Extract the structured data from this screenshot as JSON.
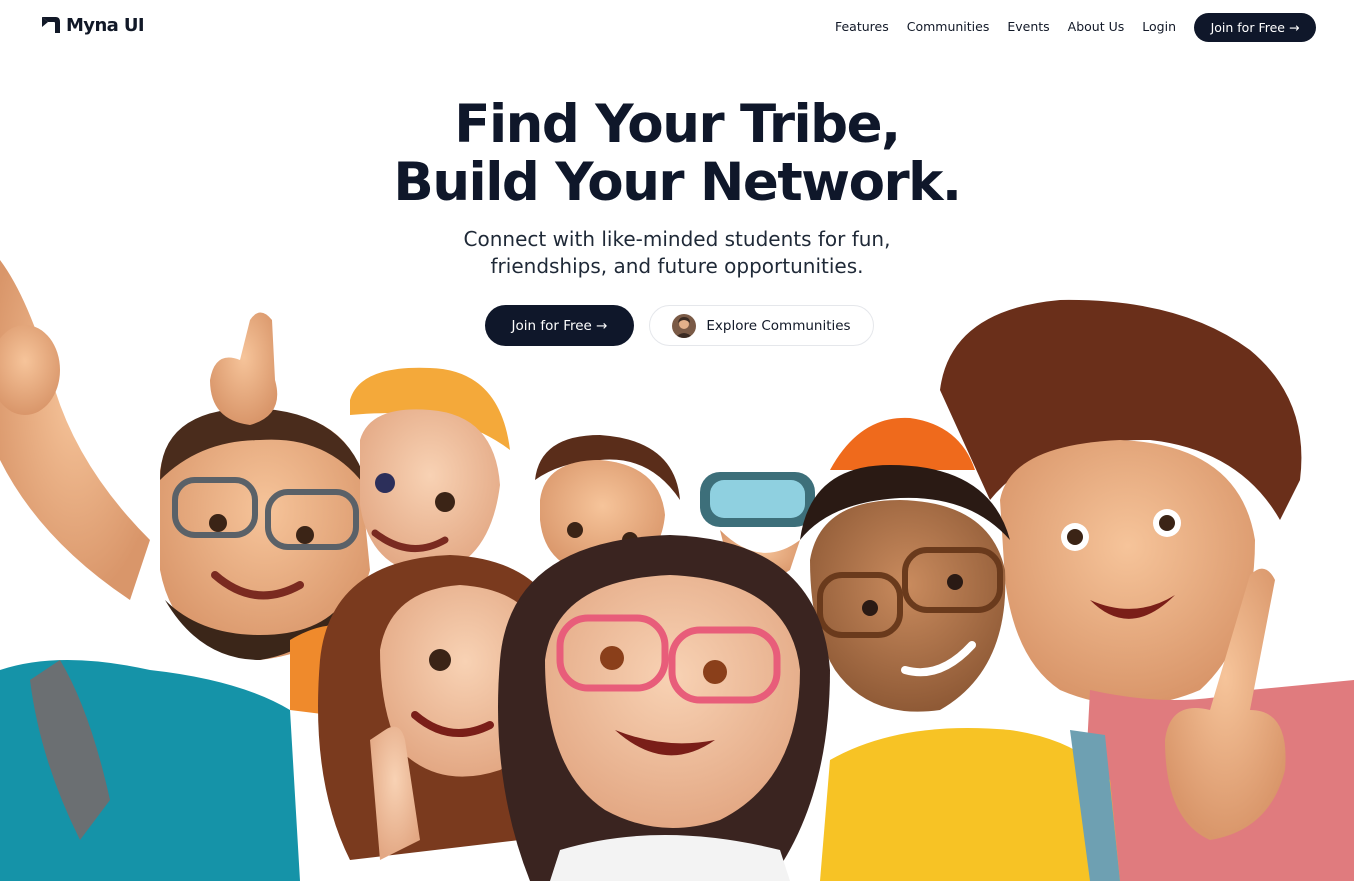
{
  "brand": {
    "name": "Myna UI"
  },
  "nav": {
    "links": [
      "Features",
      "Communities",
      "Events",
      "About Us",
      "Login"
    ],
    "cta_label": "Join for Free →"
  },
  "hero": {
    "title_line1": "Find Your Tribe,",
    "title_line2": "Build Your Network.",
    "subtitle_line1": "Connect with like-minded students for fun,",
    "subtitle_line2": "friendships, and future opportunities.",
    "primary_button": "Join for Free →",
    "secondary_button": "Explore Communities"
  },
  "colors": {
    "primary": "#0f172a",
    "text": "#111827",
    "background": "#ffffff"
  },
  "icons": [
    "myna-logo-icon",
    "arrow-right-icon",
    "avatar"
  ]
}
